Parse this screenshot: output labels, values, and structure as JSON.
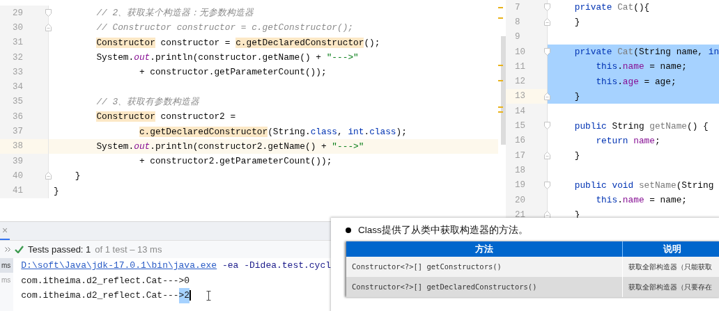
{
  "left_editor": {
    "lines": [
      {
        "number": "29",
        "current": false,
        "fold_start": true,
        "fold_end": false,
        "tokens": [
          {
            "kind": "comment",
            "text": "        // 2、获取某个构造器：无参数构造器"
          }
        ]
      },
      {
        "number": "30",
        "current": false,
        "fold_start": false,
        "fold_end": true,
        "tokens": [
          {
            "kind": "comment",
            "text": "        // Constructor constructor = c.getConstructor();"
          }
        ]
      },
      {
        "number": "31",
        "current": false,
        "fold_start": false,
        "fold_end": false,
        "tokens": [
          {
            "kind": "hl",
            "text": "        Constructor"
          },
          {
            "kind": "plain",
            "text": " constructor = "
          },
          {
            "kind": "hl",
            "text": "c.getDeclaredConstructor"
          },
          {
            "kind": "plain",
            "text": "();"
          }
        ]
      },
      {
        "number": "32",
        "current": false,
        "fold_start": false,
        "fold_end": false,
        "tokens": [
          {
            "kind": "plain",
            "text": "        System."
          },
          {
            "kind": "field",
            "text": "out"
          },
          {
            "kind": "plain",
            "text": ".println(constructor.getName() + "
          },
          {
            "kind": "string",
            "text": "\"--->\""
          }
        ]
      },
      {
        "number": "33",
        "current": false,
        "fold_start": false,
        "fold_end": false,
        "tokens": [
          {
            "kind": "plain",
            "text": "                + constructor.getParameterCount());"
          }
        ]
      },
      {
        "number": "34",
        "current": false,
        "fold_start": false,
        "fold_end": false
      },
      {
        "number": "35",
        "current": false,
        "fold_start": false,
        "fold_end": false,
        "tokens": [
          {
            "kind": "comment",
            "text": "        // 3、获取有参数构造器"
          }
        ]
      },
      {
        "number": "36",
        "current": false,
        "fold_start": false,
        "fold_end": false,
        "tokens": [
          {
            "kind": "hl",
            "text": "        Constructor"
          },
          {
            "kind": "plain",
            "text": " constructor2 ="
          }
        ]
      },
      {
        "number": "37",
        "current": false,
        "fold_start": false,
        "fold_end": false,
        "tokens": [
          {
            "kind": "hl",
            "text": "                c.getDeclaredConstructor"
          },
          {
            "kind": "plain",
            "text": "(String."
          },
          {
            "kind": "keyword",
            "text": "class"
          },
          {
            "kind": "plain",
            "text": ", "
          },
          {
            "kind": "keyword",
            "text": "int"
          },
          {
            "kind": "plain",
            "text": "."
          },
          {
            "kind": "keyword",
            "text": "class"
          },
          {
            "kind": "plain",
            "text": ");"
          }
        ]
      },
      {
        "number": "38",
        "current": true,
        "fold_start": false,
        "fold_end": false,
        "tokens": [
          {
            "kind": "plain",
            "text": "        System."
          },
          {
            "kind": "field",
            "text": "out"
          },
          {
            "kind": "plain",
            "text": ".println(constructor2.getName() + "
          },
          {
            "kind": "string",
            "text": "\"--->\""
          }
        ]
      },
      {
        "number": "39",
        "current": false,
        "fold_start": false,
        "fold_end": false,
        "tokens": [
          {
            "kind": "plain",
            "text": "                + constructor2.getParameterCount());"
          }
        ]
      },
      {
        "number": "40",
        "current": false,
        "fold_start": false,
        "fold_end": true,
        "tokens": [
          {
            "kind": "plain",
            "text": "    }"
          }
        ]
      },
      {
        "number": "41",
        "current": false,
        "fold_start": false,
        "fold_end": false,
        "tokens": [
          {
            "kind": "plain",
            "text": "}"
          }
        ]
      }
    ]
  },
  "right_editor": {
    "lines": [
      {
        "number": "7",
        "current": false,
        "selected": false,
        "fold_start": true,
        "fold_end": false,
        "tokens": [
          {
            "kind": "keyword",
            "text": "    private"
          },
          {
            "kind": "unused",
            "text": " Cat"
          },
          {
            "kind": "plain",
            "text": "(){"
          }
        ]
      },
      {
        "number": "8",
        "current": false,
        "selected": false,
        "fold_start": false,
        "fold_end": true,
        "tokens": [
          {
            "kind": "plain",
            "text": "    }"
          }
        ]
      },
      {
        "number": "9",
        "current": false,
        "selected": false,
        "fold_start": false,
        "fold_end": false
      },
      {
        "number": "10",
        "current": false,
        "selected": true,
        "fold_start": true,
        "fold_end": false,
        "tokens": [
          {
            "kind": "keyword",
            "text": "    private"
          },
          {
            "kind": "unused",
            "text": " Cat"
          },
          {
            "kind": "plain",
            "text": "(String name, "
          },
          {
            "kind": "keyword",
            "text": "in"
          }
        ]
      },
      {
        "number": "11",
        "current": false,
        "selected": true,
        "fold_start": false,
        "fold_end": false,
        "tokens": [
          {
            "kind": "keyword",
            "text": "        this"
          },
          {
            "kind": "plain",
            "text": "."
          },
          {
            "kind": "member",
            "text": "name"
          },
          {
            "kind": "plain",
            "text": " = name;"
          }
        ]
      },
      {
        "number": "12",
        "current": false,
        "selected": true,
        "fold_start": false,
        "fold_end": false,
        "tokens": [
          {
            "kind": "keyword",
            "text": "        this"
          },
          {
            "kind": "plain",
            "text": "."
          },
          {
            "kind": "member",
            "text": "age"
          },
          {
            "kind": "plain",
            "text": " = age;"
          }
        ]
      },
      {
        "number": "13",
        "current": true,
        "selected": true,
        "fold_start": false,
        "fold_end": true,
        "tokens": [
          {
            "kind": "plain",
            "text": "    }"
          }
        ]
      },
      {
        "number": "14",
        "current": false,
        "selected": false,
        "fold_start": false,
        "fold_end": false
      },
      {
        "number": "15",
        "current": false,
        "selected": false,
        "fold_start": true,
        "fold_end": false,
        "tokens": [
          {
            "kind": "keyword",
            "text": "    public"
          },
          {
            "kind": "plain",
            "text": " String "
          },
          {
            "kind": "unused",
            "text": "getName"
          },
          {
            "kind": "plain",
            "text": "() {"
          }
        ]
      },
      {
        "number": "16",
        "current": false,
        "selected": false,
        "fold_start": false,
        "fold_end": false,
        "tokens": [
          {
            "kind": "keyword",
            "text": "        return"
          },
          {
            "kind": "member",
            "text": " name"
          },
          {
            "kind": "plain",
            "text": ";"
          }
        ]
      },
      {
        "number": "17",
        "current": false,
        "selected": false,
        "fold_start": false,
        "fold_end": true,
        "tokens": [
          {
            "kind": "plain",
            "text": "    }"
          }
        ]
      },
      {
        "number": "18",
        "current": false,
        "selected": false,
        "fold_start": false,
        "fold_end": false
      },
      {
        "number": "19",
        "current": false,
        "selected": false,
        "fold_start": true,
        "fold_end": false,
        "tokens": [
          {
            "kind": "keyword",
            "text": "    public void"
          },
          {
            "kind": "unused",
            "text": " setName"
          },
          {
            "kind": "plain",
            "text": "(String"
          }
        ]
      },
      {
        "number": "20",
        "current": false,
        "selected": false,
        "fold_start": false,
        "fold_end": false,
        "tokens": [
          {
            "kind": "keyword",
            "text": "        this"
          },
          {
            "kind": "plain",
            "text": "."
          },
          {
            "kind": "member",
            "text": "name"
          },
          {
            "kind": "plain",
            "text": " = name;"
          }
        ]
      },
      {
        "number": "21",
        "current": false,
        "selected": false,
        "fold_start": false,
        "fold_end": true,
        "tokens": [
          {
            "kind": "plain",
            "text": "    }"
          }
        ]
      }
    ]
  },
  "run_panel": {
    "close": "×",
    "status_passed": "Tests passed: 1",
    "status_detail": "of 1 test – 13 ms",
    "tests": [
      {
        "text": "ms",
        "selected": true
      },
      {
        "text": "ms",
        "selected": false
      }
    ],
    "console": [
      {
        "kind": "command",
        "link": "D:\\soft\\Java\\jdk-17.0.1\\bin\\java.exe",
        "rest": "-ea -Didea.test.cycl"
      },
      {
        "kind": "output",
        "text": "com.itheima.d2_reflect.Cat--->0"
      },
      {
        "kind": "output",
        "text": "com.itheima.d2_reflect.Cat---",
        "selected_text": ">2"
      }
    ]
  },
  "slide": {
    "bullet": "Class提供了从类中获取构造器的方法。",
    "table": {
      "columns": [
        "方法",
        "说明"
      ],
      "rows": [
        [
          "Constructor<?>[] getConstructors()",
          "获取全部构造器（只能获取"
        ],
        [
          "Constructor<?>[] getDeclaredConstructors()",
          "获取全部构造器（只要存在"
        ]
      ]
    }
  }
}
